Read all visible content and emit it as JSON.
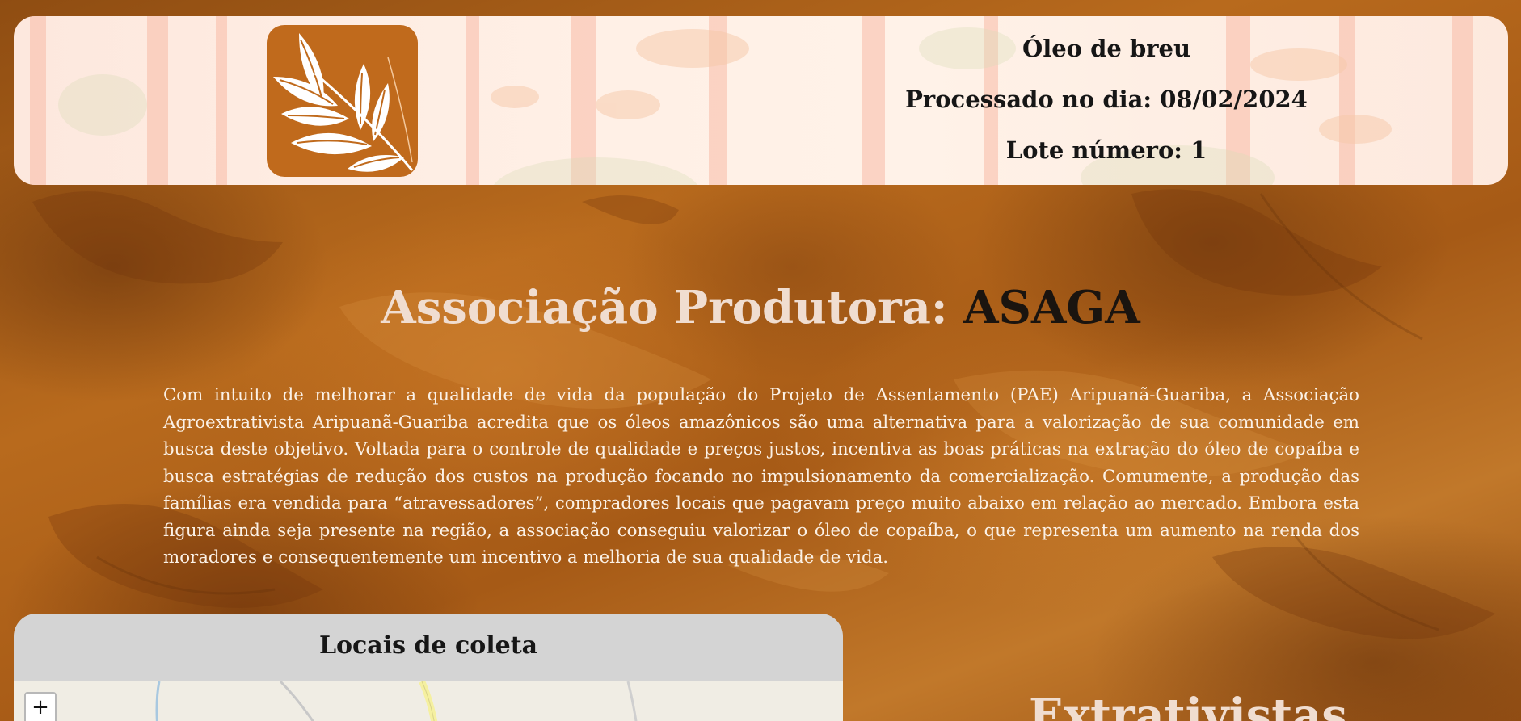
{
  "header": {
    "product_name": "Óleo de breu",
    "processed_label": "Processado no dia:",
    "processed_date": "08/02/2024",
    "lot_label": "Lote número:",
    "lot_number": "1"
  },
  "association": {
    "label": "Associação Produtora:",
    "name": "ASAGA",
    "description": "Com intuito de melhorar a qualidade de vida da população do Projeto de Assentamento (PAE) Aripuanã-Guariba, a Associação Agroextrativista Aripuanã-Guariba acredita que os óleos amazônicos são uma alternativa para a valorização de sua comunidade em busca deste objetivo. Voltada para o controle de qualidade e preços justos, incentiva as boas práticas na extração do óleo de copaíba e busca estratégias de redução dos custos na produção focando no impulsionamento da comercialização. Comumente, a produção das famílias era vendida para “atravessadores”, compradores locais que pagavam preço muito abaixo em relação ao mercado. Embora esta figura ainda seja presente na região, a associação conseguiu valorizar o óleo de copaíba, o que representa um aumento na renda dos moradores e consequentemente um incentivo a melhoria de sua qualidade de vida."
  },
  "map_section": {
    "title": "Locais de coleta",
    "zoom_in_label": "+"
  },
  "extractivists": {
    "title": "Extrativistas"
  },
  "colors": {
    "header_bg": "#fff0e6",
    "logo_bg": "#c06a1c",
    "title_light": "#f0ddd0",
    "title_dark": "#1a140f",
    "page_bg": "#b3661a",
    "map_card_header": "#d4d4d4"
  },
  "icons": {
    "logo": "leaf-branch-icon",
    "zoom": "plus-icon"
  }
}
